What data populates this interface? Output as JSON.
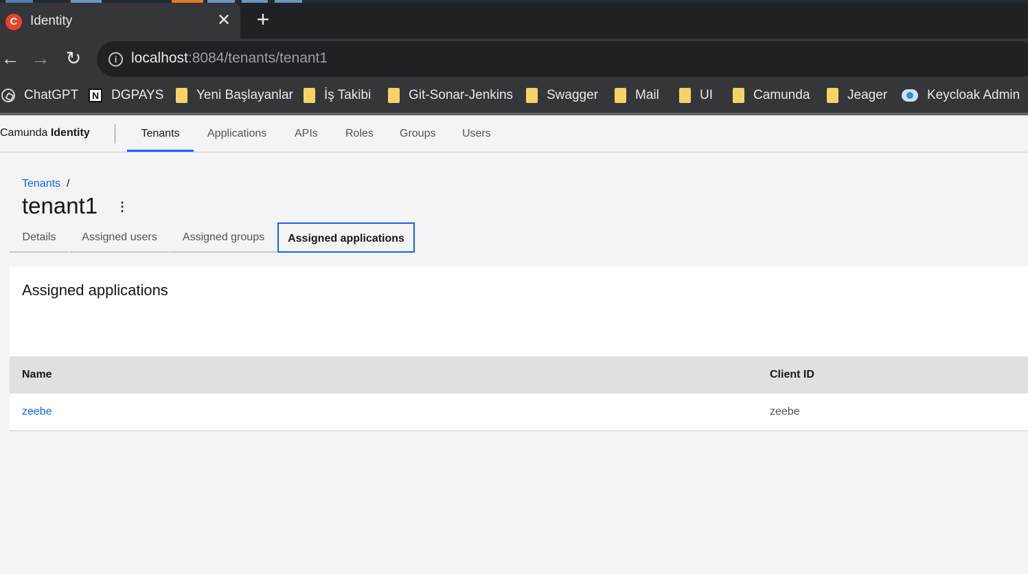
{
  "browser": {
    "tab_title": "Identity",
    "tab_favicon": "camunda-icon",
    "url_host": "localhost",
    "url_path": ":8084/tenants/tenant1",
    "bookmarks": [
      {
        "label": "ChatGPT",
        "icon": "chatgpt-icon"
      },
      {
        "label": "DGPAYS",
        "icon": "notion-icon"
      },
      {
        "label": "Yeni Başlayanlar",
        "icon": "folder-icon"
      },
      {
        "label": "İş Takibi",
        "icon": "folder-icon"
      },
      {
        "label": "Git-Sonar-Jenkins",
        "icon": "folder-icon"
      },
      {
        "label": "Swagger",
        "icon": "folder-icon"
      },
      {
        "label": "Mail",
        "icon": "folder-icon"
      },
      {
        "label": "UI",
        "icon": "folder-icon"
      },
      {
        "label": "Camunda",
        "icon": "folder-icon"
      },
      {
        "label": "Jeager",
        "icon": "folder-icon"
      },
      {
        "label": "Keycloak Admin",
        "icon": "keycloak-icon"
      }
    ]
  },
  "app": {
    "brand_prefix": "Camunda ",
    "brand_name": "Identity",
    "nav": [
      "Tenants",
      "Applications",
      "APIs",
      "Roles",
      "Groups",
      "Users"
    ],
    "active_nav": "Tenants"
  },
  "page": {
    "breadcrumb": "Tenants",
    "breadcrumb_sep": "/",
    "title": "tenant1",
    "tabs": [
      "Details",
      "Assigned users",
      "Assigned groups",
      "Assigned applications"
    ],
    "active_tab": "Assigned applications"
  },
  "panel": {
    "title": "Assigned applications",
    "columns": [
      "Name",
      "Client ID"
    ],
    "rows": [
      {
        "name": "zeebe",
        "client_id": "zeebe"
      }
    ]
  },
  "colors": {
    "accent": "#0f62fe",
    "favicon": "#e8422b",
    "folder": "#f5d366"
  }
}
